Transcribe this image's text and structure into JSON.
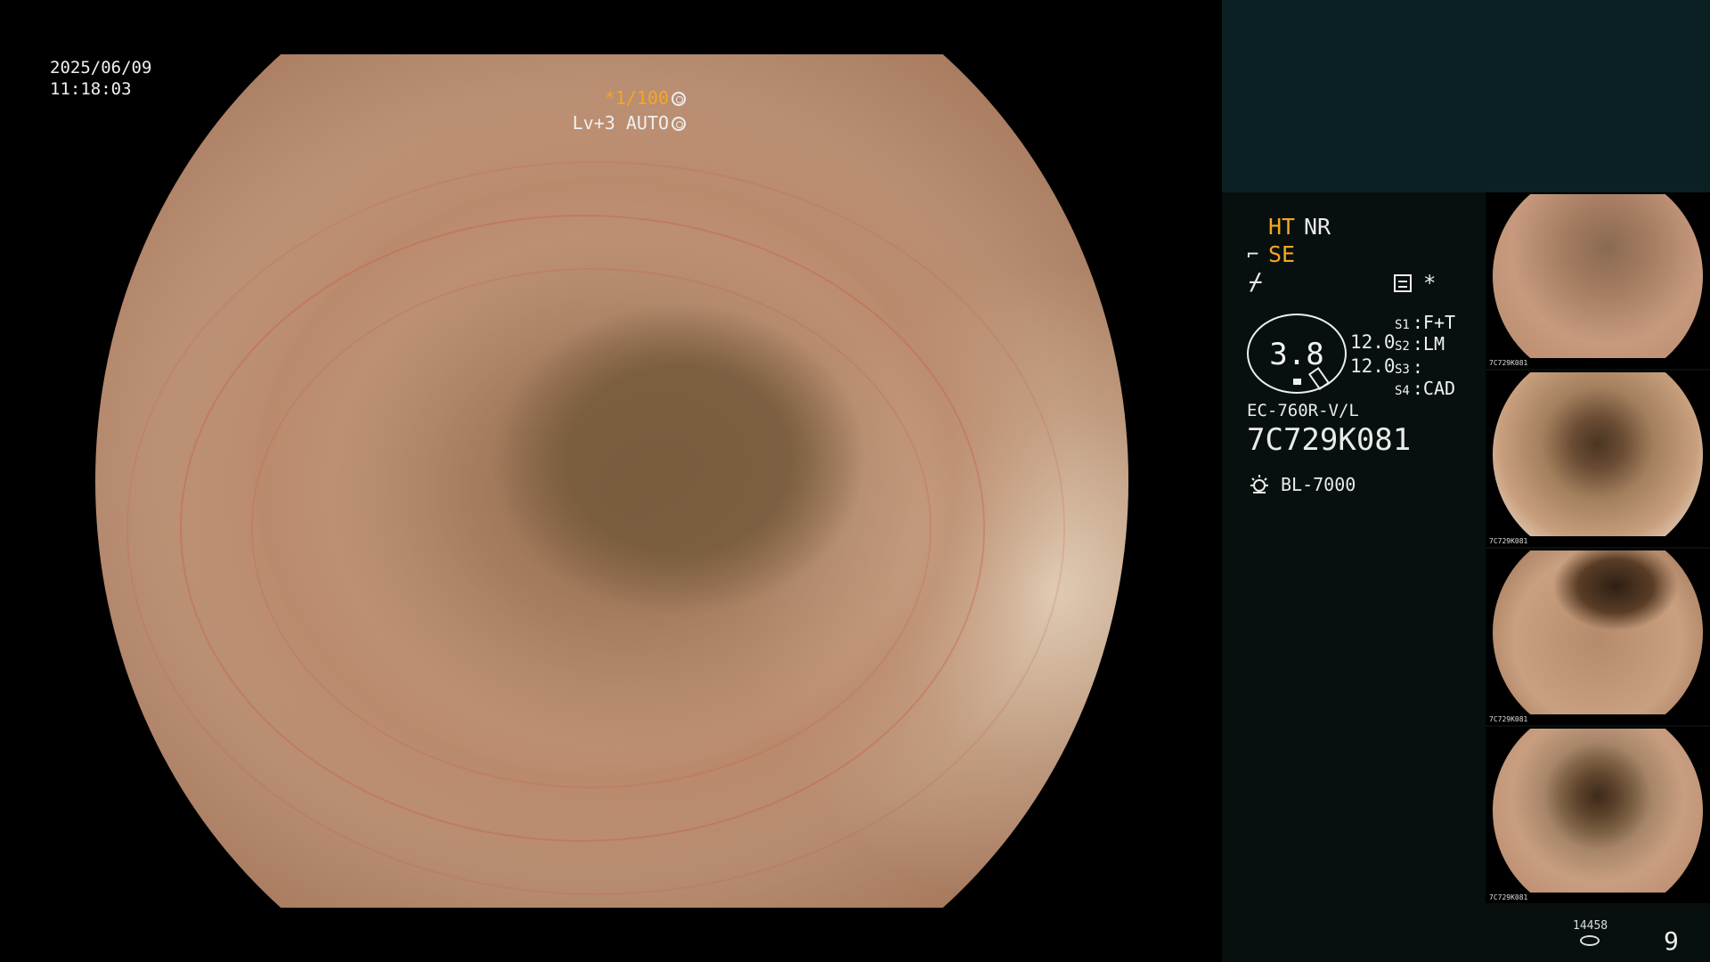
{
  "overlay": {
    "date": "2025/06/09",
    "time": "11:18:03",
    "shutter": "*1/100",
    "level": "Lv+3 AUTO"
  },
  "panel": {
    "ht": "HT",
    "nr": "NR",
    "se": "SE",
    "zoom": "3.8",
    "value_top": "12.0",
    "value_bottom": "12.0",
    "switches": [
      {
        "key": "S1",
        "label": "F+T"
      },
      {
        "key": "S2",
        "label": "LM"
      },
      {
        "key": "S3",
        "label": ""
      },
      {
        "key": "S4",
        "label": "CAD"
      }
    ],
    "scope_model": "EC-760R-V/L",
    "scope_serial": "7C729K081",
    "light_source": "BL-7000"
  },
  "thumbnails": [
    {
      "serial": "7C729K081"
    },
    {
      "serial": "7C729K081"
    },
    {
      "serial": "7C729K081"
    },
    {
      "serial": "7C729K081"
    }
  ],
  "footer": {
    "storage_count": "14458",
    "image_count": "9"
  },
  "colors": {
    "accent_amber": "#f5a623",
    "panel_teal": "#0b2022"
  }
}
